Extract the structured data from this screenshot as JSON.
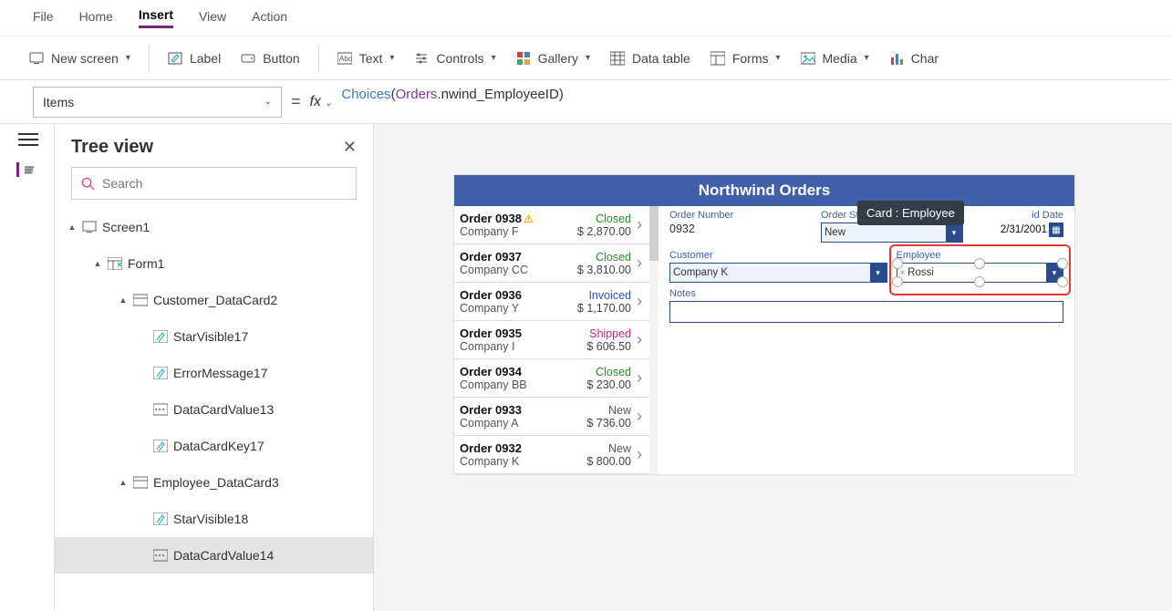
{
  "menu": {
    "file": "File",
    "home": "Home",
    "insert": "Insert",
    "view": "View",
    "action": "Action"
  },
  "toolbar": {
    "new_screen": "New screen",
    "label": "Label",
    "button": "Button",
    "text": "Text",
    "controls": "Controls",
    "gallery": "Gallery",
    "data_table": "Data table",
    "forms": "Forms",
    "media": "Media",
    "chart": "Char"
  },
  "formula": {
    "property": "Items",
    "equals": "=",
    "fx_prefix": "fx",
    "fn": "Choices",
    "arg_table": "Orders",
    "arg_field": ".nwind_EmployeeID"
  },
  "tree": {
    "title": "Tree view",
    "search_placeholder": "Search",
    "nodes": {
      "screen": "Screen1",
      "form": "Form1",
      "customer_card": "Customer_DataCard2",
      "star17": "StarVisible17",
      "err17": "ErrorMessage17",
      "dcv13": "DataCardValue13",
      "dck17": "DataCardKey17",
      "employee_card": "Employee_DataCard3",
      "star18": "StarVisible18",
      "dcv14": "DataCardValue14"
    }
  },
  "app": {
    "title": "Northwind Orders",
    "tooltip": "Card : Employee",
    "orders": [
      {
        "id": "Order 0938",
        "warn": true,
        "company": "Company F",
        "status": "Closed",
        "status_cls": "Closed",
        "amount": "$ 2,870.00"
      },
      {
        "id": "Order 0937",
        "company": "Company CC",
        "status": "Closed",
        "status_cls": "Closed",
        "amount": "$ 3,810.00"
      },
      {
        "id": "Order 0936",
        "company": "Company Y",
        "status": "Invoiced",
        "status_cls": "Invoiced",
        "amount": "$ 1,170.00"
      },
      {
        "id": "Order 0935",
        "company": "Company I",
        "status": "Shipped",
        "status_cls": "Shipped",
        "amount": "$ 606.50"
      },
      {
        "id": "Order 0934",
        "company": "Company BB",
        "status": "Closed",
        "status_cls": "Closed",
        "amount": "$ 230.00"
      },
      {
        "id": "Order 0933",
        "company": "Company A",
        "status": "New",
        "status_cls": "New",
        "amount": "$ 736.00"
      },
      {
        "id": "Order 0932",
        "company": "Company K",
        "status": "New",
        "status_cls": "New",
        "amount": "$ 800.00"
      }
    ],
    "form": {
      "order_number_lbl": "Order Number",
      "order_number": "0932",
      "order_status_lbl": "Order Status",
      "order_status": "New",
      "paid_date_lbl": "id Date",
      "paid_date": "2/31/2001",
      "customer_lbl": "Customer",
      "customer": "Company K",
      "employee_lbl": "Employee",
      "employee": "Rossi",
      "notes_lbl": "Notes"
    }
  }
}
